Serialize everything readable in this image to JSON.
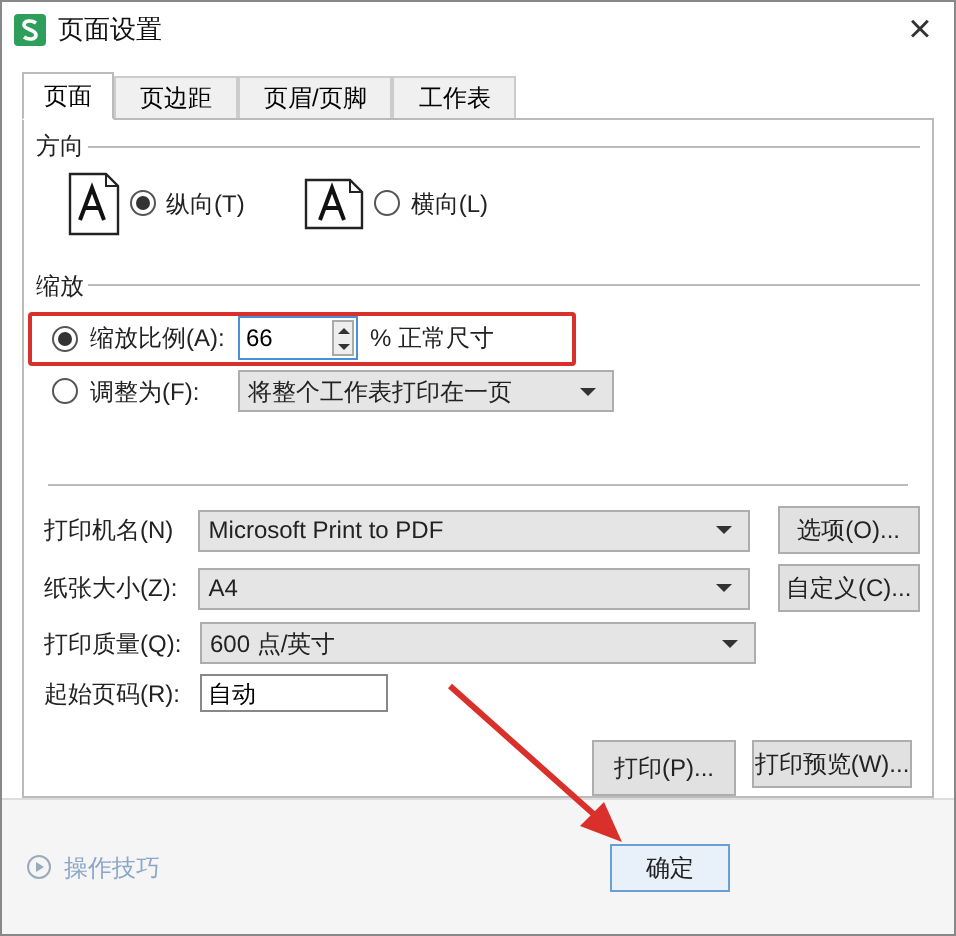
{
  "window": {
    "title": "页面设置",
    "close": "×"
  },
  "tabs": [
    {
      "label": "页面",
      "selected": true
    },
    {
      "label": "页边距",
      "selected": false
    },
    {
      "label": "页眉/页脚",
      "selected": false
    },
    {
      "label": "工作表",
      "selected": false
    }
  ],
  "orientation": {
    "title": "方向",
    "options": [
      {
        "label": "纵向(T)",
        "selected": true,
        "kind": "portrait"
      },
      {
        "label": "横向(L)",
        "selected": false,
        "kind": "landscape"
      }
    ]
  },
  "scaling": {
    "title": "缩放",
    "scale": {
      "label": "缩放比例(A):",
      "selected": true,
      "value": "66",
      "suffix": "% 正常尺寸"
    },
    "fit": {
      "label": "调整为(F):",
      "selected": false,
      "value": "将整个工作表打印在一页"
    }
  },
  "printer": {
    "label": "打印机名(N)",
    "value": "Microsoft Print to PDF",
    "button": "选项(O)..."
  },
  "paper": {
    "label": "纸张大小(Z):",
    "value": "A4",
    "button": "自定义(C)..."
  },
  "quality": {
    "label": "打印质量(Q):",
    "value": "600 点/英寸"
  },
  "first_page": {
    "label": "起始页码(R):",
    "value": "自动"
  },
  "actions": [
    "打印(P)...",
    "打印预览(W)..."
  ],
  "footer": {
    "tips": "操作技巧",
    "ok": "确定"
  }
}
